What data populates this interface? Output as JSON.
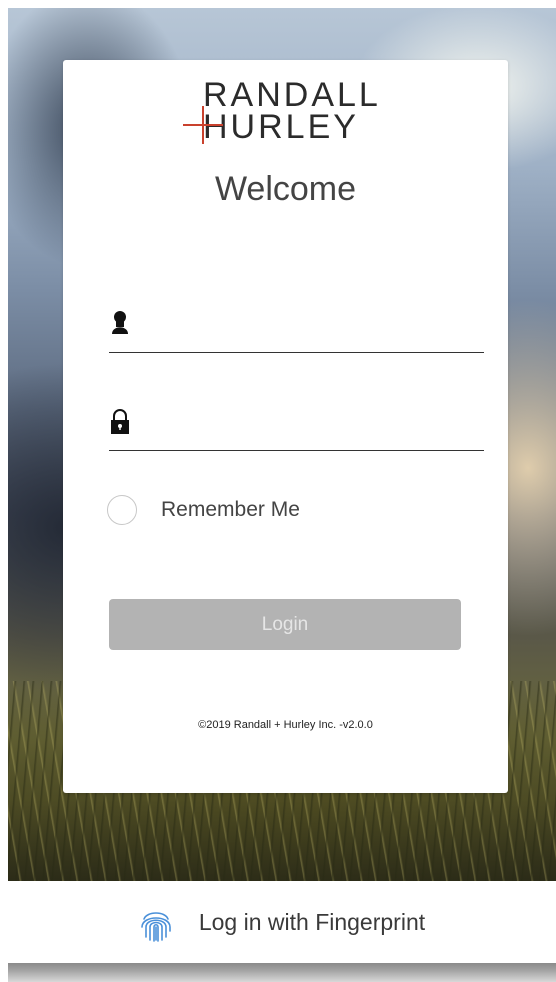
{
  "brand": {
    "logo_line1": "RANDALL",
    "logo_line2": "HURLEY",
    "accent_color": "#c9412d"
  },
  "login": {
    "title": "Welcome",
    "username_icon": "user-icon",
    "username_placeholder": "",
    "password_icon": "lock-icon",
    "password_placeholder": "",
    "remember_label": "Remember Me",
    "remember_checked": false,
    "login_label": "Login",
    "login_enabled": false,
    "copyright": "©2019 Randall + Hurley Inc. -v2.0.0"
  },
  "fingerprint": {
    "icon": "fingerprint-icon",
    "label": "Log in with Fingerprint",
    "icon_color": "#4a90d9"
  }
}
